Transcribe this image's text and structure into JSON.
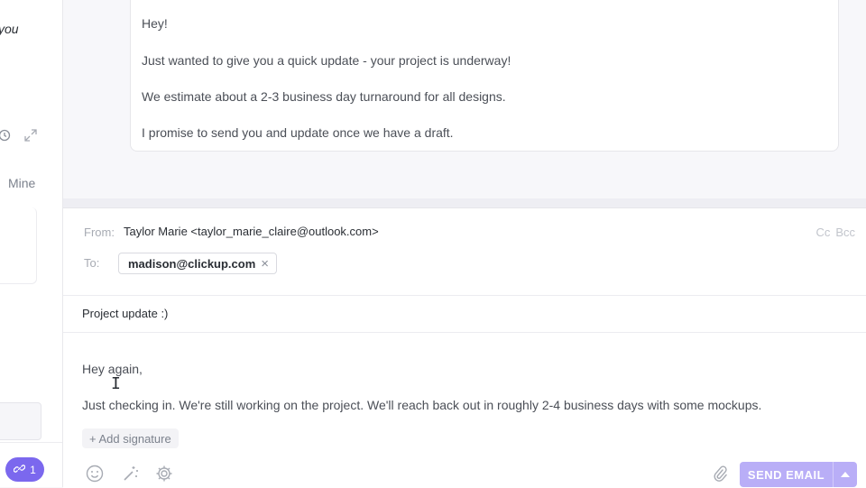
{
  "sidebar": {
    "snippet": "you",
    "tab_mine": "Mine",
    "attachments_count": "1"
  },
  "previous_email": {
    "lines": [
      "Hey!",
      "Just wanted to give you a quick update - your project is underway!",
      "We estimate about a 2-3 business day turnaround for all designs.",
      "I promise to send you and update once we have a draft."
    ]
  },
  "compose": {
    "from_label": "From:",
    "from_value": "Taylor Marie <taylor_marie_claire@outlook.com>",
    "cc_label": "Cc",
    "bcc_label": "Bcc",
    "to_label": "To:",
    "recipient": "madison@clickup.com",
    "subject": "Project update :)",
    "body_greeting": "Hey again,",
    "body_text": "Just checking in. We're still working on the project. We'll reach back out in roughly 2-4 business days with some mockups.",
    "add_signature_label": "+ Add signature",
    "send_label": "SEND EMAIL"
  },
  "colors": {
    "accent": "#7b68ee",
    "send_button": "#b9aef7"
  },
  "icons": [
    "clock-icon",
    "expand-icon",
    "link-icon",
    "emoji-icon",
    "magic-wand-icon",
    "gear-icon",
    "paperclip-icon",
    "caret-up-icon",
    "close-icon",
    "text-cursor-icon"
  ]
}
